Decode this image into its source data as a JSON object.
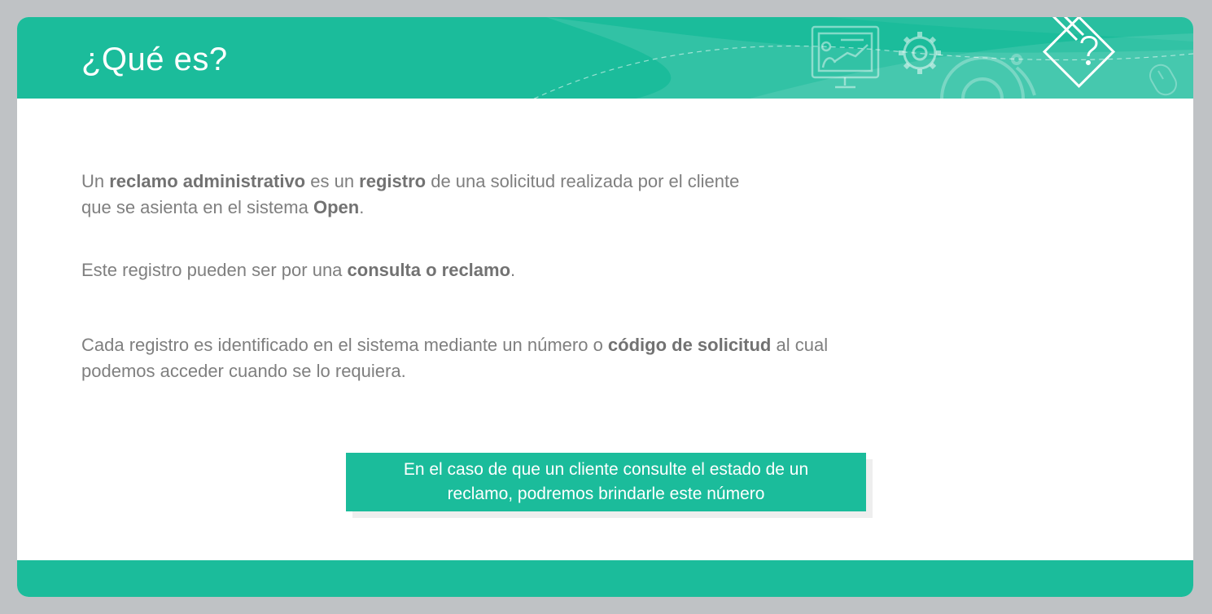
{
  "header": {
    "title": "¿Qué es?"
  },
  "paragraphs": {
    "p1": [
      {
        "text": "Un ",
        "bold": false
      },
      {
        "text": "reclamo administrativo",
        "bold": true
      },
      {
        "text": " es un ",
        "bold": false
      },
      {
        "text": "registro",
        "bold": true
      },
      {
        "text": " de una solicitud realizada por el cliente",
        "bold": false
      },
      {
        "br": true
      },
      {
        "text": "que se asienta en el sistema ",
        "bold": false
      },
      {
        "text": "Open",
        "bold": true
      },
      {
        "text": ".",
        "bold": false
      }
    ],
    "p2": [
      {
        "text": "Este registro pueden ser por una ",
        "bold": false
      },
      {
        "text": "consulta o reclamo",
        "bold": true
      },
      {
        "text": ".",
        "bold": false
      }
    ],
    "p3": [
      {
        "text": "Cada registro es identificado en el sistema mediante un número o ",
        "bold": false
      },
      {
        "text": "código de solicitud",
        "bold": true
      },
      {
        "text": " al cual",
        "bold": false
      },
      {
        "br": true
      },
      {
        "text": "podemos acceder cuando se lo requiera.",
        "bold": false
      }
    ]
  },
  "callout": {
    "line1": "En el caso de que un cliente consulte el estado de un",
    "line2": "reclamo, podremos brindarle este número"
  },
  "icons": [
    "presentation-board-icon",
    "gear-icon",
    "large-gear-icon",
    "pencil-question-icon",
    "mouse-icon"
  ],
  "colors": {
    "accent": "#1bbc9b",
    "background": "#bfc2c5",
    "text": "#7f7f7f"
  }
}
